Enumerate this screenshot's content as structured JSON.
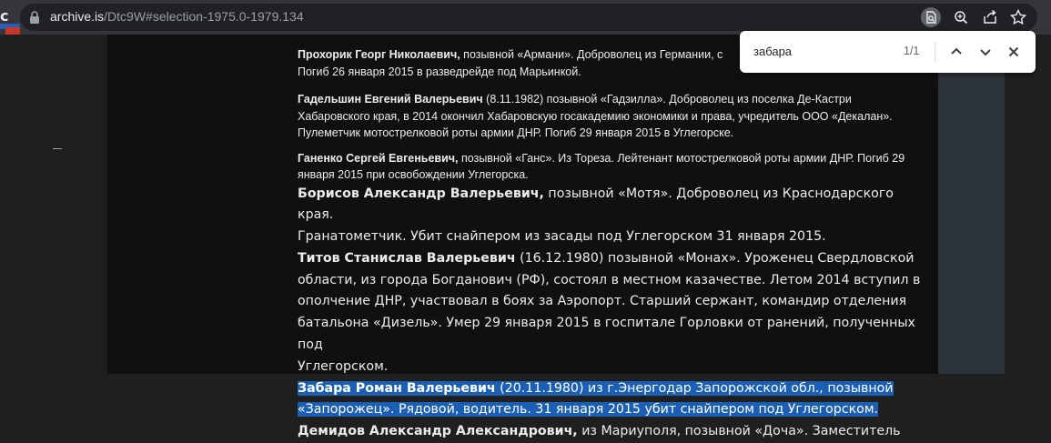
{
  "browser": {
    "url_host": "archive.is",
    "url_path": "/Dtc9W#selection-1975.0-1979.134",
    "icons": [
      "lock-icon",
      "find-in-page-icon",
      "zoom-icon",
      "share-icon",
      "bookmark-star-icon",
      "extensions-icon"
    ]
  },
  "find_bar": {
    "query": "забара",
    "count": "1/1",
    "icons": [
      "chevron-up-icon",
      "chevron-down-icon",
      "close-icon"
    ]
  },
  "entries_small": [
    {
      "name": "Прохорик Георг Николаевич,",
      "line1": " позывной «Армани». Доброволец из Германии, с",
      "line2": "Погиб 26 января 2015 в разведрейде под Марьинкой."
    },
    {
      "name": "Гадельшин Евгений Валерьевич",
      "line1": " (8.11.1982) позывной «Гадзилла». Доброволец из поселка Де-Кастри",
      "line2": "Хабаровского края, в 2014 окончил Хабаровскую госакадемию экономики и права, учредитель ООО «Декалан».",
      "line3": "Пулеметчик мотострелковой роты армии ДНР. Погиб 29 января 2015 в Углегорске."
    },
    {
      "name": "Ганенко Сергей Евгеньевич,",
      "line1": " позывной «Ганс». Из Тореза. Лейтенант мотострелковой роты армии ДНР. Погиб 29",
      "line2": "января 2015 при освобождении Углегорска."
    }
  ],
  "entries_big": [
    {
      "name": "Борисов Александр Валерьевич,",
      "line1": " позывной «Мотя». Доброволец из Краснодарского края.",
      "line2": "Гранатометчик. Убит снайпером из засады под Углегорском 31 января 2015."
    },
    {
      "name": "Титов Станислав Валерьевич",
      "line1": " (16.12.1980) позывной «Монах». Уроженец Свердловской",
      "line2": "области, из города Богданович (РФ), состоял в местном казачестве. Летом 2014 вступил в",
      "line3": "ополчение ДНР, участвовал в боях за Аэропорт. Старший сержант, командир отделения",
      "line4": "батальона «Дизель». Умер 29 января 2015 в госпитале Горловки от ранений, полученных под",
      "line5": "Углегорском."
    },
    {
      "name": "Забара Роман Валерьевич",
      "line1": " (20.11.1980) из г.Энергодар Запорожской обл., позывной",
      "line2": "«Запорожец». Рядовой, водитель. 31 января 2015 убит снайпером под Углегорском."
    },
    {
      "name": "Демидов Александр Александрович,",
      "line1": " из Мариуполя, позывной «Доча». Заместитель"
    }
  ]
}
